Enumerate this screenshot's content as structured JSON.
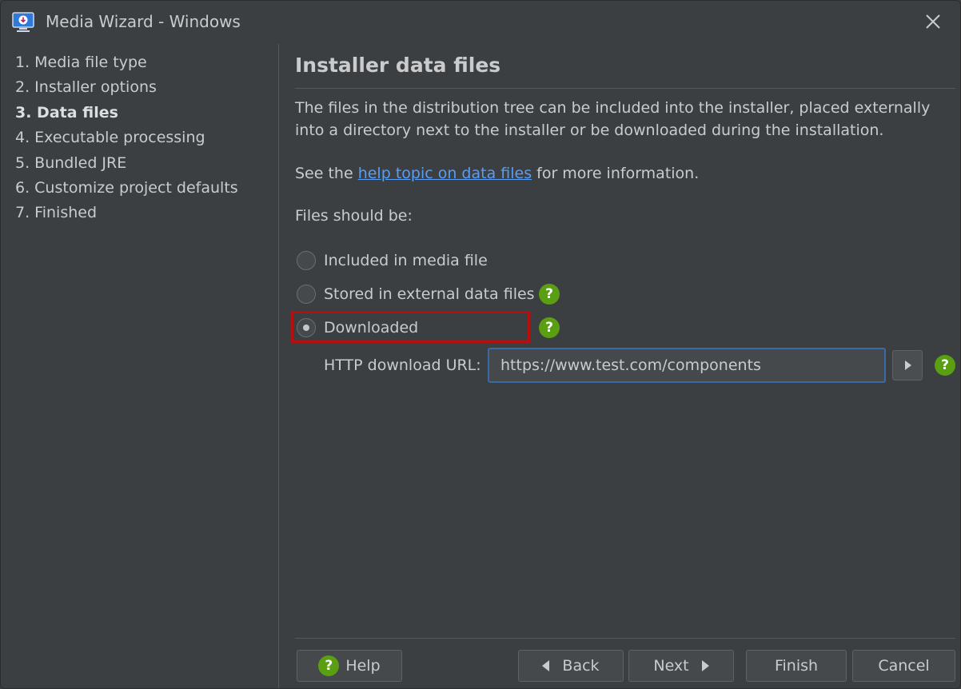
{
  "window": {
    "title": "Media Wizard - Windows"
  },
  "steps": [
    {
      "label": "1. Media file type"
    },
    {
      "label": "2. Installer options"
    },
    {
      "label": "3. Data files",
      "active": true
    },
    {
      "label": "4. Executable processing"
    },
    {
      "label": "5. Bundled JRE"
    },
    {
      "label": "6. Customize project defaults"
    },
    {
      "label": "7. Finished"
    }
  ],
  "main": {
    "heading": "Installer data files",
    "description": "The files in the distribution tree can be included into the installer, placed externally into a directory next to the installer or be downloaded during the installation.",
    "see_prefix": "See the ",
    "see_link": "help topic on data files",
    "see_suffix": " for more information.",
    "files_label": "Files should be:",
    "options": [
      {
        "label": "Included in media file",
        "selected": false
      },
      {
        "label": "Stored in external data files",
        "selected": false
      },
      {
        "label": "Downloaded",
        "selected": true
      }
    ],
    "url_label": "HTTP download URL:",
    "url_value": "https://www.test.com/components",
    "help_glyph": "?"
  },
  "buttons": {
    "help": "Help",
    "back": "Back",
    "next": "Next",
    "finish": "Finish",
    "cancel": "Cancel"
  },
  "colors": {
    "background": "#3b3f42",
    "link": "#589df6",
    "help_green": "#5a9e12",
    "highlight_red": "#b70f0f",
    "focus_blue": "#3a6aa4"
  },
  "icons": {
    "app": "monitor-download-icon",
    "close": "close-icon",
    "help": "question-icon",
    "back": "triangle-left-icon",
    "next": "triangle-right-icon",
    "url_action": "triangle-right-icon"
  }
}
